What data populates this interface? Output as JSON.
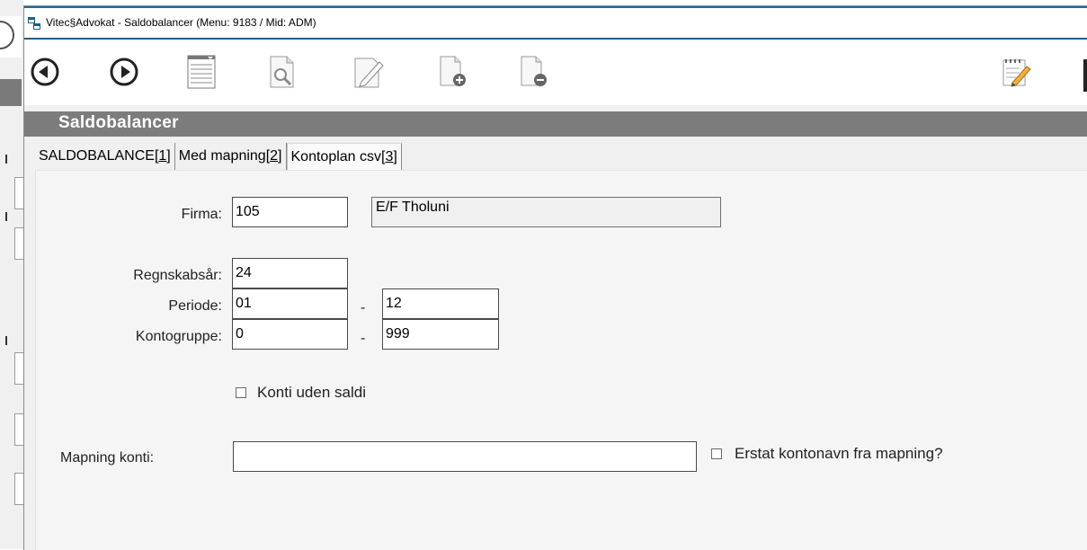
{
  "window": {
    "title": "Vitec§Advokat - Saldobalancer (Menu: 9183 / Mid: ADM)"
  },
  "toolbar": {
    "buttons": [
      {
        "name": "back",
        "icon": "back-arrow-icon"
      },
      {
        "name": "forward",
        "icon": "forward-arrow-icon"
      },
      {
        "name": "list",
        "icon": "list-document-icon"
      },
      {
        "name": "search",
        "icon": "search-document-icon"
      },
      {
        "name": "edit",
        "icon": "edit-document-icon"
      },
      {
        "name": "new",
        "icon": "new-document-icon"
      },
      {
        "name": "delete",
        "icon": "delete-document-icon"
      },
      {
        "name": "notes",
        "icon": "notepad-icon"
      }
    ]
  },
  "section": {
    "title": "Saldobalancer"
  },
  "tabs": [
    {
      "label": "SALDOBALANCE[",
      "key": "1",
      "suffix": "]"
    },
    {
      "label": "Med mapning[",
      "key": "2",
      "suffix": "]"
    },
    {
      "label": "Kontoplan csv[",
      "key": "3",
      "suffix": "]"
    }
  ],
  "active_tab": 2,
  "form": {
    "firma_label": "Firma:",
    "firma_value": "105",
    "firma_name": "E/F Tholuni",
    "regnskabsaar_label": "Regnskabsår:",
    "regnskabsaar_value": "24",
    "periode_label": "Periode:",
    "periode_from": "01",
    "periode_to": "12",
    "kontogruppe_label": "Kontogruppe:",
    "kontogruppe_from": "0",
    "kontogruppe_to": "999",
    "range_separator": "-",
    "konti_uden_saldi_label": "Konti uden saldi",
    "mapning_label": "Mapning konti:",
    "mapning_value": "",
    "erstat_label": "Erstat kontonavn fra mapning?"
  },
  "colors": {
    "header_bg": "#7c7c7c",
    "title_accent": "#2b6a96",
    "panel_bg": "#f5f5f5"
  }
}
